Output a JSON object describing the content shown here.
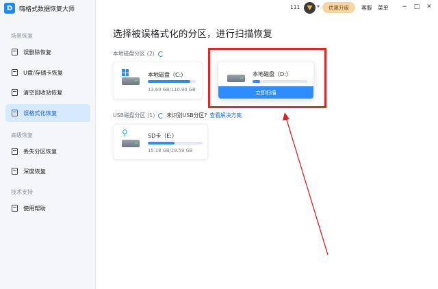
{
  "app": {
    "title": "嗨格式数据恢复大师",
    "logo_letter": "D"
  },
  "sidebar": {
    "groups": [
      {
        "title": "场景恢复"
      },
      {
        "title": "高级恢复"
      },
      {
        "title": "技术支持"
      }
    ],
    "items": [
      {
        "label": "误删除恢复",
        "icon": "trash-restore-icon",
        "active": false
      },
      {
        "label": "U盘/存储卡恢复",
        "icon": "usb-drive-icon",
        "active": false
      },
      {
        "label": "清空回收站恢复",
        "icon": "recycle-bin-icon",
        "active": false
      },
      {
        "label": "误格式化恢复",
        "icon": "format-disk-icon",
        "active": true
      },
      {
        "label": "丢失分区恢复",
        "icon": "lost-partition-icon",
        "active": false
      },
      {
        "label": "深度恢复",
        "icon": "deep-scan-icon",
        "active": false
      },
      {
        "label": "使用帮助",
        "icon": "help-book-icon",
        "active": false
      }
    ]
  },
  "titlebar": {
    "count": "111",
    "upgrade_label": "优惠升级",
    "service_label": "客服",
    "menu_label": "菜单",
    "minimize": "−",
    "maximize": "□",
    "close": "✕"
  },
  "main": {
    "title": "选择被误格式化的分区，进行扫描恢复",
    "local_section": {
      "label": "本地磁盘分区",
      "count": "(2)"
    },
    "usb_section": {
      "label": "USB磁盘分区",
      "count": "(1)",
      "note": "未识别USB分区?",
      "link": "查看解决方案"
    },
    "disks": [
      {
        "name": "本地磁盘（C:）",
        "size": "13.60 GB/110.94 GB",
        "usage": 0.88
      },
      {
        "name": "本地磁盘（D:）",
        "size": "",
        "usage": 0.14,
        "scan_label": "立即扫描"
      }
    ],
    "usb_disks": [
      {
        "name": "SD卡（E:）",
        "size": "15.18 GB/29.59 GB",
        "usage": 0.49
      }
    ]
  },
  "colors": {
    "accent": "#2f8cff",
    "active_bg": "#d6e9ff",
    "highlight": "#e12727",
    "upgrade_bg": "#f5d6a3"
  }
}
